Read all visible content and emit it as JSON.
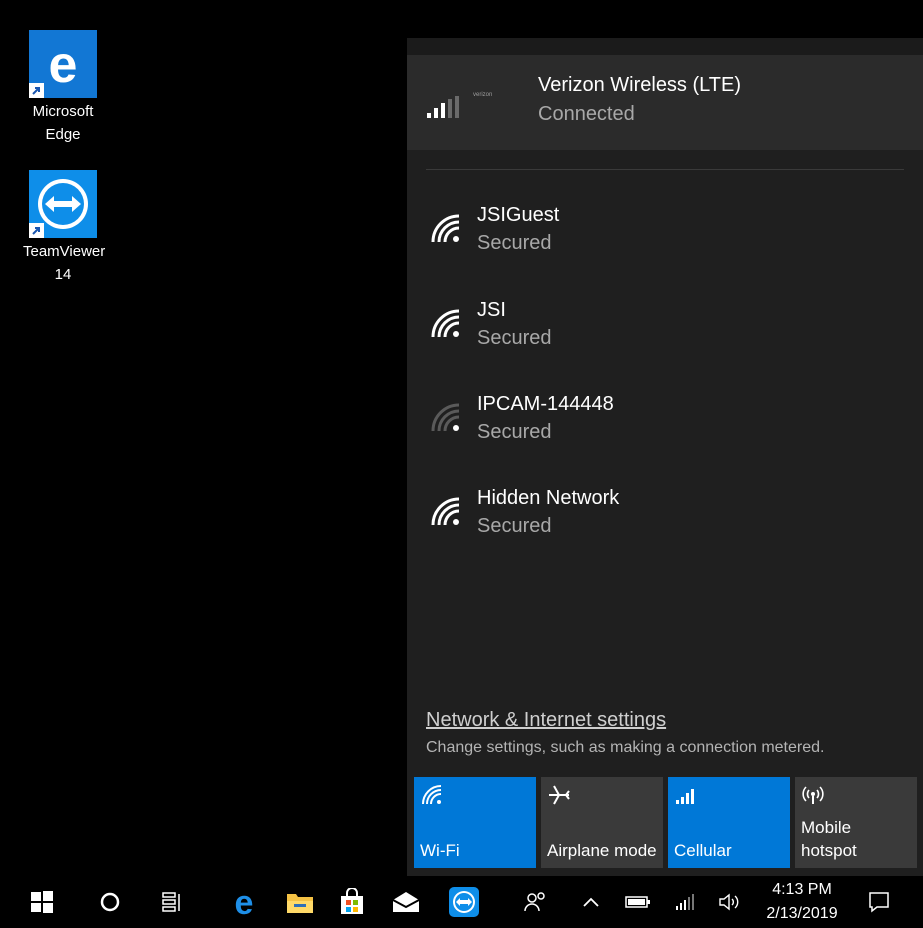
{
  "desktop": {
    "icons": [
      {
        "label": "Microsoft\nEdge",
        "icon": "edge-icon"
      },
      {
        "label": "TeamViewer\n14",
        "icon": "teamviewer-icon"
      }
    ]
  },
  "flyout": {
    "connected": {
      "name": "Verizon Wireless (LTE)",
      "status": "Connected",
      "carrier": "verizon"
    },
    "networks": [
      {
        "name": "JSIGuest",
        "status": "Secured"
      },
      {
        "name": "JSI",
        "status": "Secured"
      },
      {
        "name": "IPCAM-144448",
        "status": "Secured"
      },
      {
        "name": "Hidden Network",
        "status": "Secured"
      }
    ],
    "settings_link": "Network & Internet settings",
    "settings_desc": "Change settings, such as making a connection metered.",
    "quick_actions": [
      {
        "label": "Wi-Fi",
        "icon": "wifi-icon",
        "active": true
      },
      {
        "label": "Airplane mode",
        "icon": "airplane-icon",
        "active": false
      },
      {
        "label": "Cellular",
        "icon": "cellular-icon",
        "active": true
      },
      {
        "label": "Mobile\nhotspot",
        "icon": "hotspot-icon",
        "active": false
      }
    ]
  },
  "taskbar": {
    "time": "4:13 PM",
    "date": "2/13/2019",
    "icons": [
      "start-icon",
      "search-icon",
      "task-view-icon",
      "edge-icon",
      "file-explorer-icon",
      "store-icon",
      "mail-icon",
      "teamviewer-icon"
    ],
    "tray": [
      "people-icon",
      "chevron-up-icon",
      "battery-icon",
      "cellular-signal-icon",
      "volume-icon",
      "action-center-icon"
    ]
  },
  "colors": {
    "accent": "#0078d7",
    "flyout_bg": "#1f1f1f",
    "connected_bg": "#2b2b2b",
    "tile_off": "#3a3a3a"
  }
}
